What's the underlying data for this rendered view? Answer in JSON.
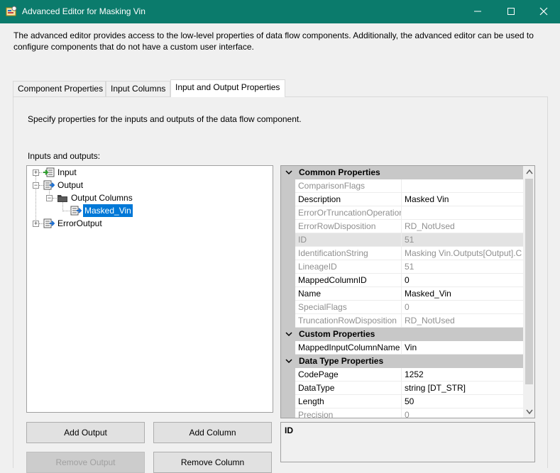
{
  "window": {
    "title": "Advanced Editor for Masking Vin",
    "minimize": "—",
    "maximize": "☐",
    "close": "✕"
  },
  "description": "The advanced editor provides access to the low-level properties of data flow components. Additionally, the advanced editor can be used to configure components that do not have a custom user interface.",
  "tabs": [
    {
      "label": "Component Properties",
      "active": false
    },
    {
      "label": "Input Columns",
      "active": false
    },
    {
      "label": "Input and Output Properties",
      "active": true
    }
  ],
  "panel": {
    "instruction": "Specify properties for the inputs and outputs of the data flow component.",
    "io_label": "Inputs and outputs:"
  },
  "tree": [
    {
      "label": "Input",
      "expander": "+"
    },
    {
      "label": "Output",
      "expander": "−"
    },
    {
      "label": "Output Columns",
      "expander": "−"
    },
    {
      "label": "Masked_Vin",
      "selected": true
    },
    {
      "label": "ErrorOutput",
      "expander": "+"
    }
  ],
  "buttons": {
    "add_output": "Add Output",
    "add_column": "Add Column",
    "remove_output": "Remove Output",
    "remove_column": "Remove Column"
  },
  "properties": {
    "common": {
      "label": "Common Properties",
      "rows": [
        {
          "name": "ComparisonFlags",
          "value": "",
          "dim": true
        },
        {
          "name": "Description",
          "value": "Masked Vin",
          "dim": false
        },
        {
          "name": "ErrorOrTruncationOperation",
          "value": "",
          "dim": true
        },
        {
          "name": "ErrorRowDisposition",
          "value": "RD_NotUsed",
          "dim": true
        },
        {
          "name": "ID",
          "value": "51",
          "dim": true
        },
        {
          "name": "IdentificationString",
          "value": "Masking Vin.Outputs[Output].C",
          "dim": true
        },
        {
          "name": "LineageID",
          "value": "51",
          "dim": true
        },
        {
          "name": "MappedColumnID",
          "value": "0",
          "dim": false
        },
        {
          "name": "Name",
          "value": "Masked_Vin",
          "dim": false
        },
        {
          "name": "SpecialFlags",
          "value": "0",
          "dim": true
        },
        {
          "name": "TruncationRowDisposition",
          "value": "RD_NotUsed",
          "dim": true
        }
      ]
    },
    "custom": {
      "label": "Custom Properties",
      "rows": [
        {
          "name": "MappedInputColumnName",
          "value": "Vin",
          "dim": false
        }
      ]
    },
    "datatype": {
      "label": "Data Type Properties",
      "rows": [
        {
          "name": "CodePage",
          "value": "1252",
          "dim": false
        },
        {
          "name": "DataType",
          "value": "string [DT_STR]",
          "dim": false
        },
        {
          "name": "Length",
          "value": "50",
          "dim": false
        },
        {
          "name": "Precision",
          "value": "0",
          "dim": true
        }
      ]
    }
  },
  "description_box": {
    "title": "ID"
  },
  "colors": {
    "titlebar": "#0b7b6c",
    "selection": "#0078d7"
  }
}
